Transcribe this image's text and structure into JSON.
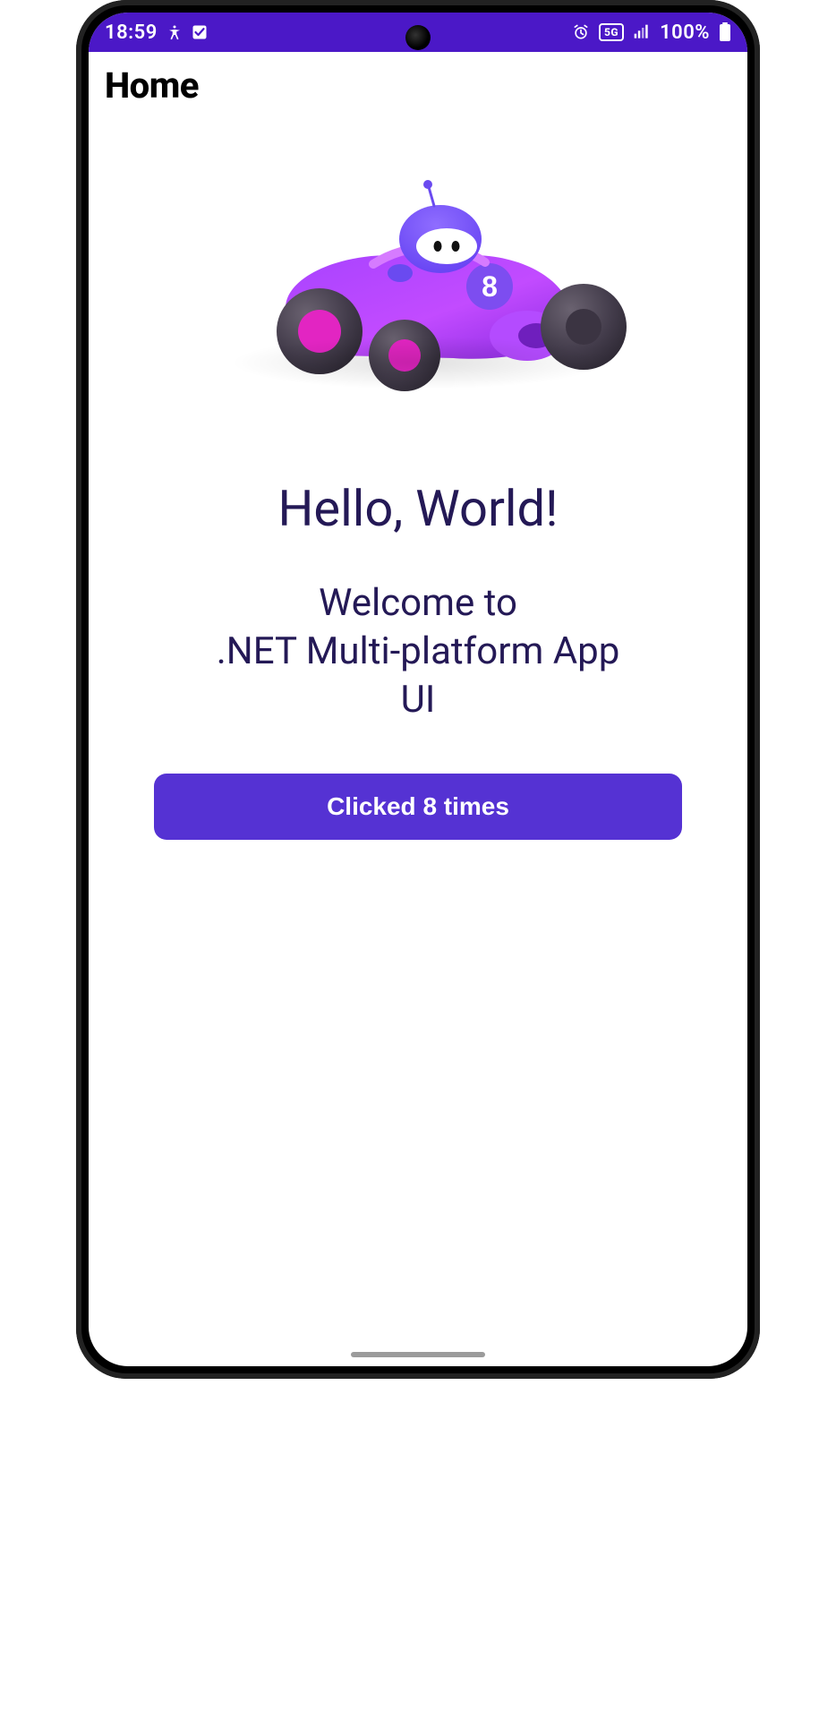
{
  "status_bar": {
    "time": "18:59",
    "battery_text": "100%",
    "network_label": "5G",
    "icons": {
      "accessibility": "accessibility-icon",
      "checkbox": "checkbox-icon",
      "alarm": "alarm-icon",
      "network5g": "network-5g-icon",
      "signal": "cell-signal-icon",
      "battery": "battery-icon"
    }
  },
  "page": {
    "title": "Home"
  },
  "hero": {
    "image_name": "dotnet-bot-racecar",
    "car_number": "8"
  },
  "content": {
    "headline": "Hello, World!",
    "subhead_line1": "Welcome to",
    "subhead_line2": ".NET Multi-platform App",
    "subhead_line3": "UI"
  },
  "button": {
    "label": "Clicked 8 times"
  },
  "colors": {
    "status_bar_bg": "#4b18c7",
    "accent": "#5532d3",
    "text_dark": "#241956"
  }
}
